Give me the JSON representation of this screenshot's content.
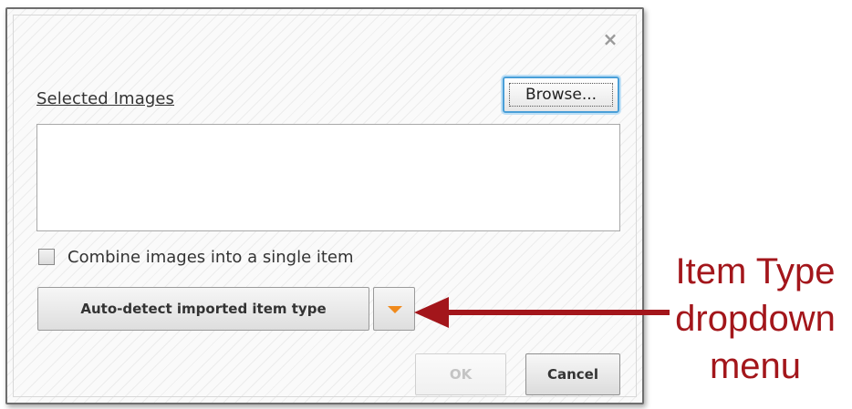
{
  "dialog": {
    "close_glyph": "×",
    "selected_images_label": "Selected Images",
    "browse_label": "Browse...",
    "combine_label": "Combine images into a single item",
    "combine_checked": false,
    "item_type_label": "Auto-detect imported item type",
    "dropdown_icon": "triangle-down-icon",
    "ok_label": "OK",
    "ok_enabled": false,
    "cancel_label": "Cancel"
  },
  "annotation": {
    "lines": [
      "Item Type",
      "dropdown",
      "menu"
    ],
    "color": "#a3161b"
  },
  "colors": {
    "dropdown_accent": "#f08a1c",
    "focus_border": "#4a9fd8"
  }
}
